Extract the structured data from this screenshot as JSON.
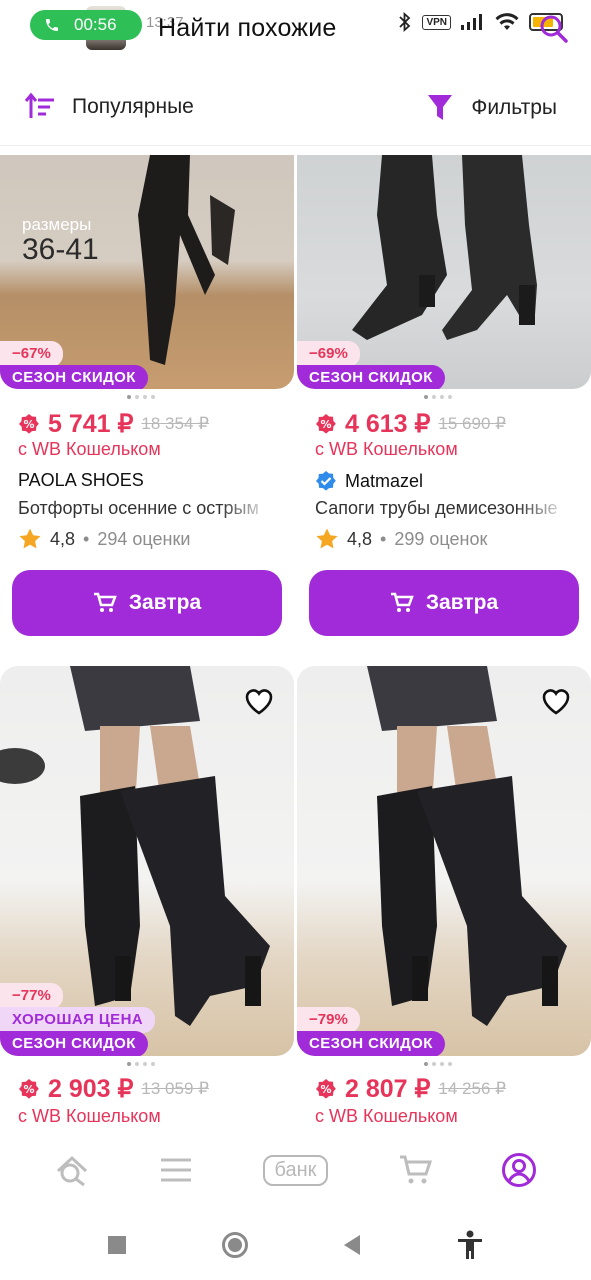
{
  "status_bar": {
    "call_timer": "00:56",
    "time_text": "13:37",
    "vpn_label": "VPN",
    "battery": "73"
  },
  "header": {
    "title": "Найти похожие"
  },
  "toolbar": {
    "sort_label": "Популярные",
    "filter_label": "Фильтры"
  },
  "products": [
    {
      "discount": "−67%",
      "season_badge": "СЕЗОН СКИДОК",
      "price": "5 741 ₽",
      "old_price": "18 354 ₽",
      "wallet": "с WB Кошельком",
      "brand": "PAOLA SHOES",
      "title": "Ботфорты осенние с острым",
      "rating": "4,8",
      "reviews": "294 оценки",
      "cart_label": "Завтра",
      "image_text_1": "размеры",
      "image_text_2": "36-41"
    },
    {
      "discount": "−69%",
      "season_badge": "СЕЗОН СКИДОК",
      "price": "4 613 ₽",
      "old_price": "15 690 ₽",
      "wallet": "с WB Кошельком",
      "brand": "Matmazel",
      "title": "Сапоги трубы демисезонные",
      "rating": "4,8",
      "reviews": "299 оценок",
      "cart_label": "Завтра"
    },
    {
      "discount": "−77%",
      "good_price_badge": "ХОРОШАЯ ЦЕНА",
      "season_badge": "СЕЗОН СКИДОК",
      "price": "2 903 ₽",
      "old_price": "13 059 ₽",
      "wallet": "с WB Кошельком"
    },
    {
      "discount": "−79%",
      "season_badge": "СЕЗОН СКИДОК",
      "price": "2 807 ₽",
      "old_price": "14 256 ₽",
      "wallet": "с WB Кошельком"
    }
  ],
  "bottom_nav": {
    "bank_label": "банк"
  },
  "colors": {
    "accent": "#a12bd8",
    "price": "#e6345a",
    "call": "#2fbf57"
  },
  "icons": [
    "phone-icon",
    "bluetooth-icon",
    "signal-icon",
    "wifi-icon",
    "battery-icon",
    "search-icon",
    "sort-icon",
    "filter-icon",
    "discount-icon",
    "verified-icon",
    "star-icon",
    "cart-icon",
    "heart-icon",
    "home-icon",
    "menu-icon",
    "bank-icon",
    "basket-icon",
    "profile-icon",
    "square-icon",
    "circle-icon",
    "back-icon",
    "accessibility-icon"
  ]
}
